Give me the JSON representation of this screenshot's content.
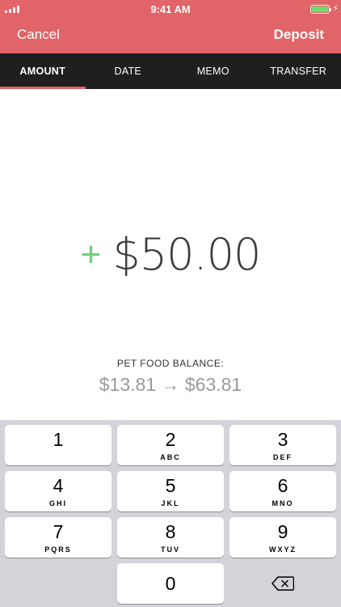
{
  "status_bar": {
    "time": "9:41 AM"
  },
  "header": {
    "cancel_label": "Cancel",
    "deposit_label": "Deposit",
    "accent_color": "#e06468"
  },
  "tabs": [
    {
      "label": "AMOUNT",
      "active": true
    },
    {
      "label": "DATE"
    },
    {
      "label": "MEMO"
    },
    {
      "label": "TRANSFER"
    }
  ],
  "amount": {
    "sign": "+",
    "value": "$50.00",
    "sign_color": "#6dcf7d"
  },
  "balance": {
    "label": "PET FOOD BALANCE:",
    "value": "$13.81 → $63.81"
  },
  "keypad": {
    "keys": [
      {
        "num": "1",
        "letters": ""
      },
      {
        "num": "2",
        "letters": "ABC"
      },
      {
        "num": "3",
        "letters": "DEF"
      },
      {
        "num": "4",
        "letters": "GHI"
      },
      {
        "num": "5",
        "letters": "JKL"
      },
      {
        "num": "6",
        "letters": "MNO"
      },
      {
        "num": "7",
        "letters": "PQRS"
      },
      {
        "num": "8",
        "letters": "TUV"
      },
      {
        "num": "9",
        "letters": "WXYZ"
      },
      {
        "num": "0",
        "letters": ""
      }
    ],
    "icons": {
      "backspace": "backspace-icon"
    }
  }
}
